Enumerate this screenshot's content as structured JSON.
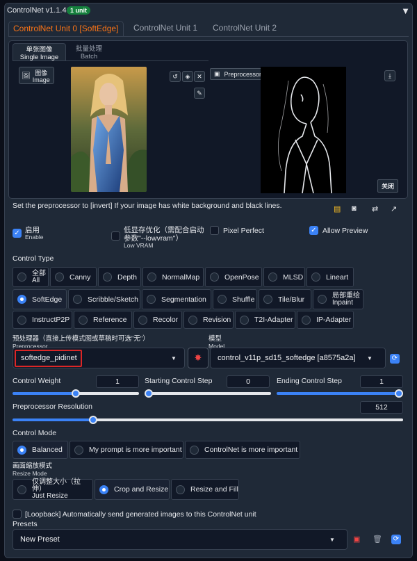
{
  "header": {
    "title": "ControlNet v1.1.410",
    "badge": "1 unit",
    "collapse_icon": "triangle-down-icon"
  },
  "tabs": [
    "ControlNet Unit 0 [SoftEdge]",
    "ControlNet Unit 1",
    "ControlNet Unit 2"
  ],
  "image_tabs": {
    "single_cn": "单张图像",
    "single_en": "Single Image",
    "batch_cn": "批量处理",
    "batch_en": "Batch"
  },
  "image_label": {
    "cn": "图像",
    "en": "Image"
  },
  "preview_label": "Preprocessor Preview",
  "close_label": "关闭",
  "note": "Set the preprocessor to [invert] If your image has white background and black lines.",
  "checks": {
    "enable_cn": "启用",
    "enable_en": "Enable",
    "lowvram_cn": "低显存优化（需配合启动",
    "lowvram_cn2": "参数\"--lowvram\"）",
    "lowvram_en": "Low VRAM",
    "pixel_perfect": "Pixel Perfect",
    "allow_preview": "Allow Preview"
  },
  "control_type": {
    "label": "Control Type",
    "all_cn": "全部",
    "all_en": "All",
    "canny": "Canny",
    "depth": "Depth",
    "normalmap": "NormalMap",
    "openpose": "OpenPose",
    "mlsd": "MLSD",
    "lineart": "Lineart",
    "softedge": "SoftEdge",
    "scribble": "Scribble/Sketch",
    "segmentation": "Segmentation",
    "shuffle": "Shuffle",
    "tileblur": "Tile/Blur",
    "inpaint_cn": "局部重绘",
    "inpaint_en": "Inpaint",
    "instructp2p": "InstructP2P",
    "reference": "Reference",
    "recolor": "Recolor",
    "revision": "Revision",
    "t2i": "T2I-Adapter",
    "ipadapter": "IP-Adapter"
  },
  "preprocessor": {
    "label_cn": "预处理器（直接上传模式图或草稿时可选\"无\"）",
    "label_en": "Preprocessor",
    "value": "softedge_pidinet"
  },
  "model": {
    "label_cn": "模型",
    "label_en": "Model",
    "value": "control_v11p_sd15_softedge [a8575a2a]"
  },
  "sliders": {
    "weight_label": "Control Weight",
    "weight": "1",
    "start_label": "Starting Control Step",
    "start": "0",
    "end_label": "Ending Control Step",
    "end": "1",
    "res_label": "Preprocessor Resolution",
    "res": "512"
  },
  "slider_levels": {
    "weight": 0.5,
    "start": 0.0,
    "end": 1.0,
    "res": 0.2
  },
  "control_mode": {
    "label": "Control Mode",
    "balanced": "Balanced",
    "prompt": "My prompt is more important",
    "controlnet": "ControlNet is more important"
  },
  "resize_mode": {
    "label_cn": "画面缩放模式",
    "label_en": "Resize Mode",
    "just_cn": "仅调整大小（拉伸）",
    "just_en": "Just Resize",
    "crop": "Crop and Resize",
    "fill": "Resize and Fill"
  },
  "loopback": "[Loopback] Automatically send generated images to this ControlNet unit",
  "presets": {
    "label": "Presets",
    "value": "New Preset"
  },
  "colors": {
    "accent": "#f97316",
    "primary": "#3b82f6",
    "highlight": "#dc2626"
  }
}
